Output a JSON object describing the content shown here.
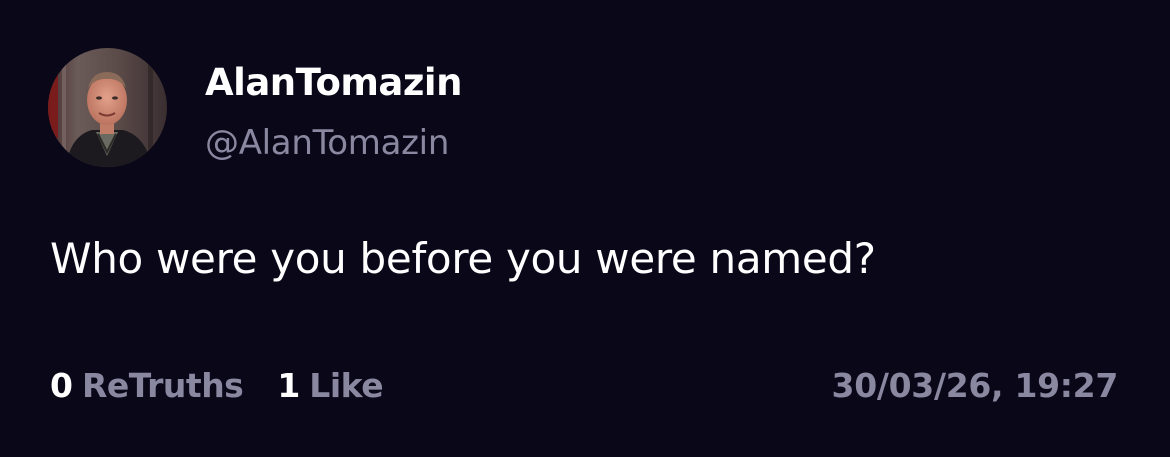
{
  "author": {
    "display_name": "AlanTomazin",
    "handle": "@AlanTomazin"
  },
  "post": {
    "text": "Who were you before you were named?",
    "retruths_count": "0",
    "retruths_label": "ReTruths",
    "likes_count": "1",
    "likes_label": "Like",
    "timestamp": "30/03/26, 19:27"
  },
  "colors": {
    "background": "#0a0719",
    "primary_text": "#ffffff",
    "secondary_text": "#8a88a0"
  }
}
